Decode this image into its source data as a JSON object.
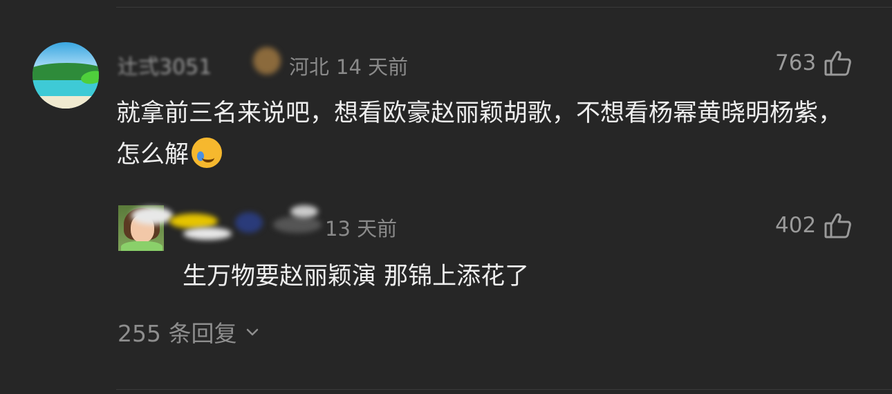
{
  "comment": {
    "username": "辻弍3051",
    "location": "河北",
    "time": "14 天前",
    "likes": "763",
    "text": "就拿前三名来说吧，想看欧豪赵丽颖胡歌，不想看杨幂黄晓明杨紫，怎么解",
    "emoji": "laughing-crying-icon"
  },
  "reply": {
    "meta": "13 天前",
    "likes": "402",
    "text": "生万物要赵丽颖演 那锦上添花了"
  },
  "more_replies": {
    "label": "255 条回复"
  },
  "colors": {
    "background": "#262626",
    "text": "#eeeeee",
    "muted": "#8a8a8a"
  }
}
